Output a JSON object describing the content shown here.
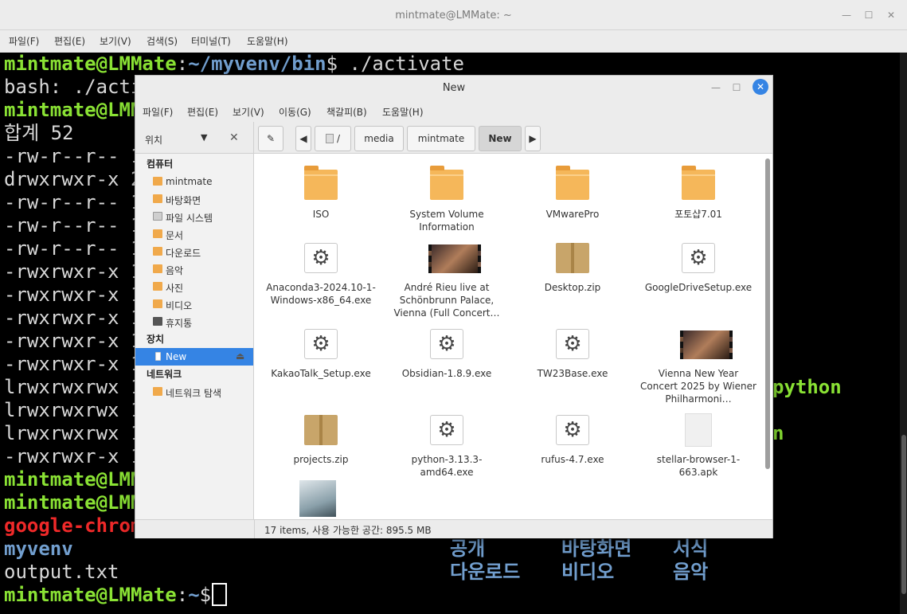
{
  "terminal": {
    "title": "mintmate@LMMate: ~",
    "menu": [
      "파일(F)",
      "편집(E)",
      "보기(V)",
      "검색(S)",
      "터미널(T)",
      "도움말(H)"
    ],
    "lines": {
      "l0_user": "mintmate@LMMate",
      "l0_colon": ":",
      "l0_path": "~/myvenv/bin",
      "l0_cmd": "$ ./activate",
      "l1": "bash: ./acti",
      "l2_user": "mintmate@LMM",
      "l3": "합계 52",
      "l4": "-rw-r--r-- 1",
      "l5": "drwxrwxr-x 2",
      "l6": "-rw-r--r-- 1",
      "l7": "-rw-r--r-- 1",
      "l8": "-rw-r--r-- 1",
      "l9": "-rwxrwxr-x 1",
      "l10": "-rwxrwxr-x 1",
      "l11": "-rwxrwxr-x 1",
      "l12": "-rwxrwxr-x 1",
      "l13": "-rwxrwxr-x 1",
      "l14": "lrwxrwxrwx 1",
      "l14_tail": "python",
      "l15": "lrwxrwxrwx 1",
      "l16": "lrwxrwxrwx 1",
      "l16_tail": "n",
      "l17": "-rwxrwxr-x 1",
      "l18_user": "mintmate@LMM",
      "l19_user": "mintmate@LMM",
      "l20_red": "google-chrom",
      "l21_blue": "myvenv",
      "l21_col1": "공개",
      "l21_col2": "바탕화면",
      "l21_col3": "서식",
      "l22": "output.txt",
      "l22_col1": "다운로드",
      "l22_col2": "비디오",
      "l22_col3": "음악",
      "l23_user": "mintmate@LMMate",
      "l23_colon": ":",
      "l23_path": "~",
      "l23_dollar": "$ "
    }
  },
  "filemanager": {
    "title": "New",
    "menu": [
      "파일(F)",
      "편집(E)",
      "보기(V)",
      "이동(G)",
      "책갈피(B)",
      "도움말(H)"
    ],
    "places_label": "위치",
    "breadcrumb": [
      "/",
      "media",
      "mintmate",
      "New"
    ],
    "sidebar": {
      "computer_head": "컴퓨터",
      "computer": [
        "mintmate",
        "바탕화면",
        "파일 시스템",
        "문서",
        "다운로드",
        "음악",
        "사진",
        "비디오",
        "휴지통"
      ],
      "devices_head": "장치",
      "devices": [
        "New"
      ],
      "network_head": "네트워크",
      "network": [
        "네트워크 탐색"
      ]
    },
    "files": [
      {
        "name": "ISO",
        "type": "folder"
      },
      {
        "name": "System Volume Information",
        "type": "folder"
      },
      {
        "name": "VMwarePro",
        "type": "folder"
      },
      {
        "name": "포토샵7.01",
        "type": "folder"
      },
      {
        "name": "Anaconda3-2024.10-1-Windows-x86_64.exe",
        "type": "exe"
      },
      {
        "name": "André Rieu live at Schönbrunn Palace, Vienna (Full Concert…",
        "type": "video"
      },
      {
        "name": "Desktop.zip",
        "type": "zip"
      },
      {
        "name": "GoogleDriveSetup.exe",
        "type": "exe"
      },
      {
        "name": "KakaoTalk_Setup.exe",
        "type": "exe"
      },
      {
        "name": "Obsidian-1.8.9.exe",
        "type": "exe"
      },
      {
        "name": "TW23Base.exe",
        "type": "exe"
      },
      {
        "name": "Vienna New Year Concert 2025 by Wiener Philharmoni…",
        "type": "video"
      },
      {
        "name": "projects.zip",
        "type": "zip"
      },
      {
        "name": "python-3.13.3-amd64.exe",
        "type": "exe"
      },
      {
        "name": "rufus-4.7.exe",
        "type": "exe"
      },
      {
        "name": "stellar-browser-1-663.apk",
        "type": "apk"
      },
      {
        "name": "",
        "type": "image"
      }
    ],
    "status": "17 items, 사용 가능한 공간: 895.5 MB"
  }
}
